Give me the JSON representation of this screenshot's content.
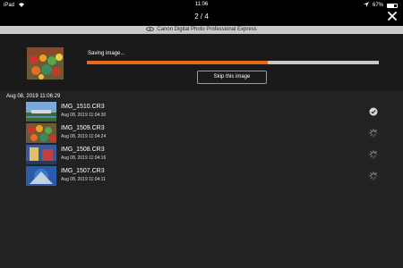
{
  "statusbar": {
    "device": "iPad",
    "time": "11:06",
    "battery_text": "67%",
    "battery_level": 0.67
  },
  "nav": {
    "counter": "2 / 4"
  },
  "banner": {
    "title": "Canon Digital Photo Professional Express"
  },
  "saving": {
    "status": "Saving image...",
    "progress": 0.62,
    "skip_label": "Skip this image",
    "accent": "#e86a14"
  },
  "list": {
    "date_header": "Aug 08, 2019  11:06:29",
    "items": [
      {
        "name": "IMG_1510.CR3",
        "time": "Aug 08, 2019  11:04:30",
        "state": "done",
        "icon": "check-circle-icon"
      },
      {
        "name": "IMG_1509.CR3",
        "time": "Aug 08, 2019  11:04:24",
        "state": "pending",
        "icon": "spinner-icon"
      },
      {
        "name": "IMG_1508.CR3",
        "time": "Aug 08, 2019  11:04:16",
        "state": "pending",
        "icon": "spinner-icon"
      },
      {
        "name": "IMG_1507.CR3",
        "time": "Aug 08, 2019  11:04:11",
        "state": "pending",
        "icon": "spinner-icon"
      }
    ]
  }
}
